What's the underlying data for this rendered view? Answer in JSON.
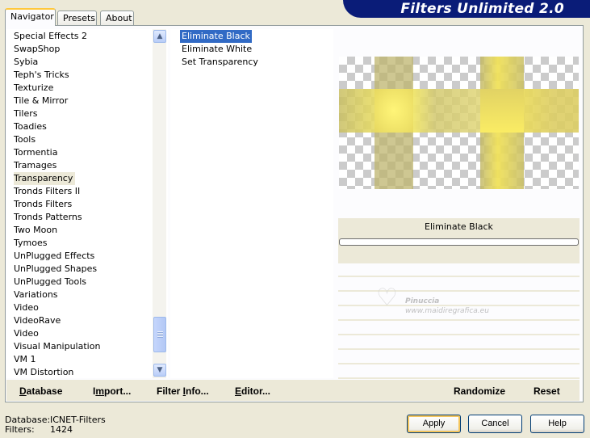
{
  "banner_title": "Filters Unlimited 2.0",
  "tabs": [
    {
      "label": "Navigator",
      "active": true
    },
    {
      "label": "Presets",
      "active": false
    },
    {
      "label": "About",
      "active": false
    }
  ],
  "categories": [
    "Special Effects 2",
    "SwapShop",
    "Sybia",
    "Teph's Tricks",
    "Texturize",
    "Tile & Mirror",
    "Tilers",
    "Toadies",
    "Tools",
    "Tormentia",
    "Tramages",
    "Transparency",
    "Tronds Filters II",
    "Tronds Filters",
    "Tronds Patterns",
    "Two Moon",
    "Tymoes",
    "UnPlugged Effects",
    "UnPlugged Shapes",
    "UnPlugged Tools",
    "Variations",
    "Video",
    "VideoRave",
    "Video",
    "Visual Manipulation",
    "VM 1",
    "VM Distortion"
  ],
  "selected_category": "Transparency",
  "filters": [
    "Eliminate Black",
    "Eliminate White",
    "Set Transparency"
  ],
  "selected_filter": "Eliminate Black",
  "preview_caption": "Eliminate Black",
  "progress_fraction": 0,
  "watermark": {
    "name": "Pinuccia",
    "url": "www.maidiregrafica.eu"
  },
  "toolbar": {
    "database": {
      "pre": "",
      "ul": "D",
      "post": "atabase"
    },
    "import": {
      "pre": "I",
      "ul": "m",
      "post": "port..."
    },
    "filter_info": {
      "pre": "Filter ",
      "ul": "I",
      "post": "nfo..."
    },
    "editor": {
      "pre": "",
      "ul": "E",
      "post": "ditor..."
    },
    "randomize": "Randomize",
    "reset": "Reset"
  },
  "status": {
    "database_label": "Database:",
    "database_value": "ICNET-Filters",
    "filters_label": "Filters:",
    "filters_value": "1424"
  },
  "buttons": {
    "apply": "Apply",
    "cancel": "Cancel",
    "help": "Help"
  },
  "colors": {
    "window_bg": "#ece9d8",
    "banner_bg": "#0a1c78",
    "selection": "#316ac5",
    "preview_yellow": "#f4e85a",
    "preview_olive": "#c2b870"
  }
}
